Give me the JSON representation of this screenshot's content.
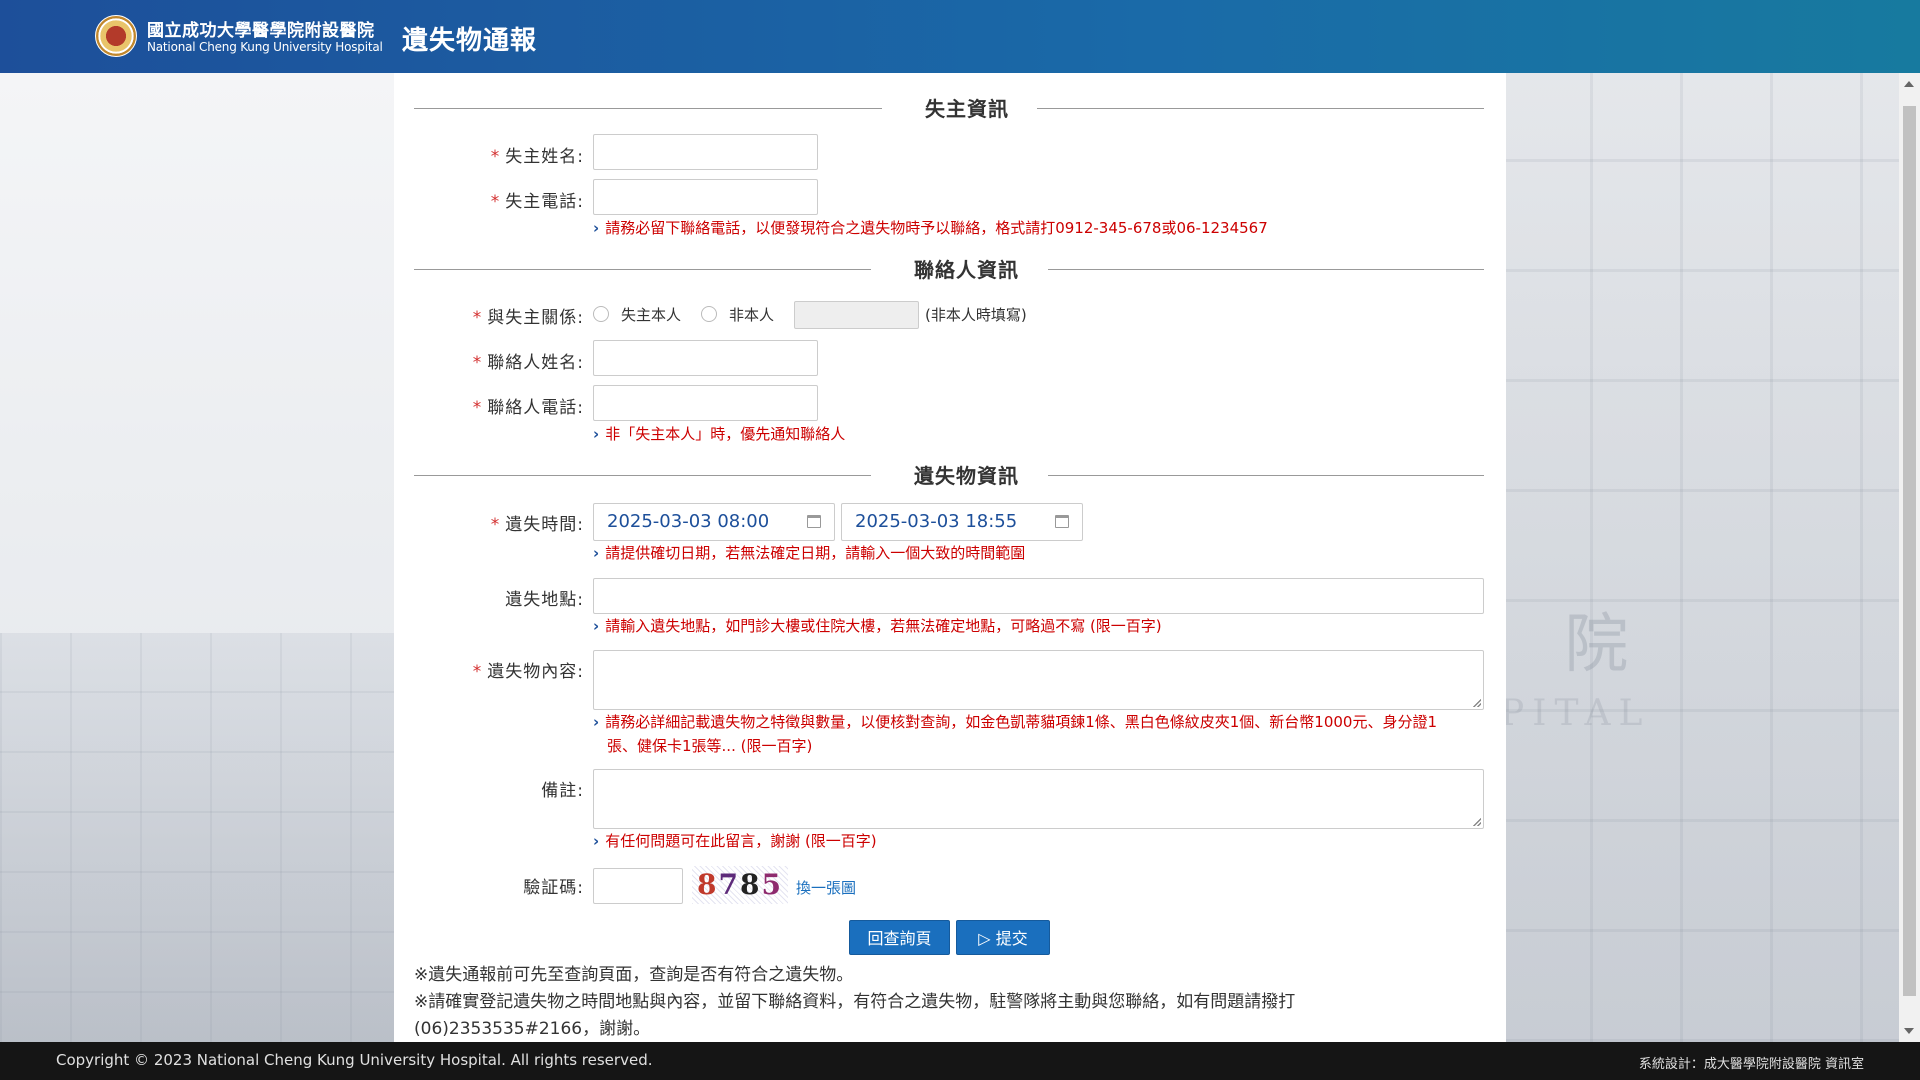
{
  "header": {
    "hospital_name_zh": "國立成功大學醫學院附設醫院",
    "hospital_name_en": "National Cheng Kung University Hospital",
    "page_title": "遺失物通報"
  },
  "owner_section": {
    "title": "失主資訊",
    "name_label": "失主姓名:",
    "phone_label": "失主電話:",
    "phone_hint": "請務必留下聯絡電話，以便發現符合之遺失物時予以聯絡，格式請打0912-345-678或06-1234567",
    "name_value": "",
    "phone_value": ""
  },
  "contact_section": {
    "title": "聯絡人資訊",
    "relation_label": "與失主關係:",
    "relation_options": [
      "失主本人",
      "非本人"
    ],
    "relation_other_note": "(非本人時填寫)",
    "name_label": "聯絡人姓名:",
    "phone_label": "聯絡人電話:",
    "phone_hint": "非「失主本人」時，優先通知聯絡人"
  },
  "item_section": {
    "title": "遺失物資訊",
    "time_label": "遺失時間:",
    "time_start": "2025-03-03 08:00",
    "time_end": "2025-03-03 18:55",
    "time_hint": "請提供確切日期，若無法確定日期，請輸入一個大致的時間範圍",
    "place_label": "遺失地點:",
    "place_hint": "請輸入遺失地點，如門診大樓或住院大樓，若無法確定地點，可略過不寫 (限一百字)",
    "content_label": "遺失物內容:",
    "content_hint_line1": "請務必詳細記載遺失物之特徵與數量，以便核對查詢，如金色凱蒂貓項鍊1條、黑白色條紋皮夾1個、新台幣1000元、身分證1",
    "content_hint_line2": "張、健保卡1張等... (限一百字)",
    "remark_label": "備註:",
    "remark_hint": "有任何問題可在此留言，謝謝 (限一百字)",
    "captcha_label": "驗証碼:",
    "captcha_digits": [
      "8",
      "7",
      "8",
      "5"
    ],
    "captcha_refresh": "換一張圖"
  },
  "required_mark": "*",
  "buttons": {
    "back": "回查詢頁",
    "submit": "提交"
  },
  "notes": {
    "line1": "※遺失通報前可先至查詢頁面，查詢是否有符合之遺失物。",
    "line2": "※請確實登記遺失物之時間地點與內容，並留下聯絡資料，有符合之遺失物，駐警隊將主動與您聯絡，如有問題請撥打",
    "line3": "(06)2353535#2166，謝謝。"
  },
  "footer": {
    "copyright": "Copyright © 2023 National Cheng Kung University Hospital. All rights reserved.",
    "credit": "系統設計：成大醫學院附設醫院 資訊室"
  },
  "background_watermark": "醫  院",
  "background_watermark2": "PITAL",
  "colors": {
    "header_start": "#1d4f9a",
    "header_end": "#177a9f",
    "accent": "#1a6fbe",
    "hint_red": "#cc0000",
    "required_red": "#d32f2f"
  },
  "icons": [
    "hospital-logo-icon",
    "calendar-icon",
    "chevron-right-icon",
    "send-icon"
  ]
}
